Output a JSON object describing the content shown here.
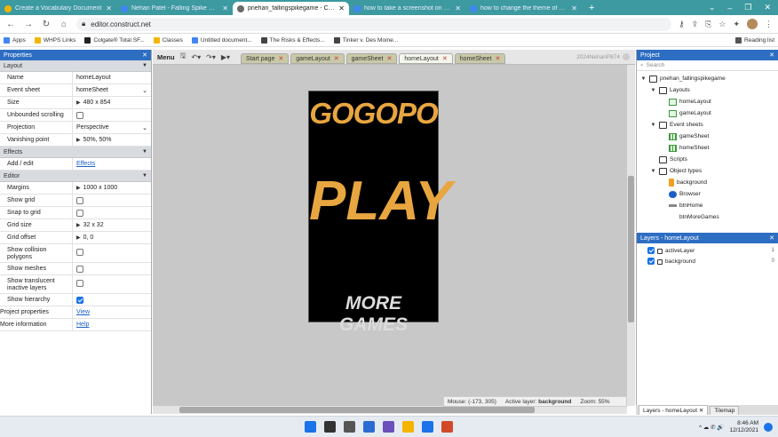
{
  "browser": {
    "tabs": [
      {
        "title": "Create a Vocabulary Document",
        "fav": "#f4b400"
      },
      {
        "title": "Nehan Patel - Falling Spike Game",
        "fav": "#4285f4"
      },
      {
        "title": "pnehan_fallingspikegame - Construct",
        "fav": "#6a6a6a"
      },
      {
        "title": "how to take a screenshot on windows",
        "fav": "#4285f4"
      },
      {
        "title": "how to change the theme of construct",
        "fav": "#4285f4"
      }
    ],
    "new_tab": "+",
    "window_controls": [
      "⌄",
      "–",
      "❐",
      "✕"
    ],
    "url": "editor.construct.net",
    "bookmarks": [
      {
        "label": "Apps",
        "color": "#4285f4"
      },
      {
        "label": "WHPS Links",
        "color": "#f4b400"
      },
      {
        "label": "Colgate® Total SF...",
        "color": "#222222"
      },
      {
        "label": "Classes",
        "color": "#f4b400"
      },
      {
        "label": "Untitled document...",
        "color": "#4285f4"
      },
      {
        "label": "The Risks & Effects...",
        "color": "#444444"
      },
      {
        "label": "Tinker v. Des Moine...",
        "color": "#444444"
      }
    ],
    "reading_list": "Reading list"
  },
  "properties": {
    "title": "Properties",
    "sections": {
      "layout": "Layout",
      "effects": "Effects",
      "editor": "Editor"
    },
    "layout_rows": {
      "name_label": "Name",
      "name_value": "homeLayout",
      "eventsheet_label": "Event sheet",
      "eventsheet_value": "homeSheet",
      "size_label": "Size",
      "size_value": "480 x 854",
      "unbounded_label": "Unbounded scrolling",
      "projection_label": "Projection",
      "projection_value": "Perspective",
      "vanishing_label": "Vanishing point",
      "vanishing_value": "50%, 50%"
    },
    "effects_rows": {
      "addedit_label": "Add / edit",
      "addedit_value": "Effects"
    },
    "editor_rows": {
      "margins_label": "Margins",
      "margins_value": "1000 x 1000",
      "showgrid_label": "Show grid",
      "snapgrid_label": "Snap to grid",
      "gridsize_label": "Grid size",
      "gridsize_value": "32 x 32",
      "gridoffset_label": "Grid offset",
      "gridoffset_value": "0, 0",
      "collision_label": "Show collision polygons",
      "meshes_label": "Show meshes",
      "translucent_label": "Show translucent inactive layers",
      "hierarchy_label": "Show hierarchy"
    },
    "project_props_label": "Project properties",
    "project_props_value": "View",
    "more_info_label": "More information",
    "more_info_value": "Help"
  },
  "editor": {
    "menu": "Menu",
    "tabs": [
      {
        "label": "Start page",
        "active": false
      },
      {
        "label": "gameLayout",
        "active": false
      },
      {
        "label": "gameSheet",
        "active": false
      },
      {
        "label": "homeLayout",
        "active": true
      },
      {
        "label": "homeSheet",
        "active": false
      }
    ],
    "user": "2024NehanP874",
    "canvas": {
      "title_text": "GOGOPO",
      "play_text": "PLAY",
      "more_games_text": "MORE GAMES"
    },
    "status": {
      "mouse": "Mouse: (-173, 305)",
      "active_layer_label": "Active layer:",
      "active_layer_value": "background",
      "zoom": "Zoom: 55%"
    }
  },
  "project": {
    "title": "Project",
    "search_placeholder": "Search",
    "tree": [
      {
        "label": "pnehan_fallingspikegame",
        "indent": 0,
        "icon": "folder",
        "arrow": "▼"
      },
      {
        "label": "Layouts",
        "indent": 1,
        "icon": "folder",
        "arrow": "▼"
      },
      {
        "label": "homeLayout",
        "indent": 2,
        "icon": "layout",
        "arrow": ""
      },
      {
        "label": "gameLayout",
        "indent": 2,
        "icon": "layout",
        "arrow": ""
      },
      {
        "label": "Event sheets",
        "indent": 1,
        "icon": "folder",
        "arrow": "▼"
      },
      {
        "label": "gameSheet",
        "indent": 2,
        "icon": "sheet",
        "arrow": ""
      },
      {
        "label": "homeSheet",
        "indent": 2,
        "icon": "sheet",
        "arrow": ""
      },
      {
        "label": "Scripts",
        "indent": 1,
        "icon": "folder",
        "arrow": ""
      },
      {
        "label": "Object types",
        "indent": 1,
        "icon": "folder",
        "arrow": "▼"
      },
      {
        "label": "background",
        "indent": 2,
        "icon": "sprite",
        "arrow": ""
      },
      {
        "label": "Browser",
        "indent": 2,
        "icon": "browser",
        "arrow": ""
      },
      {
        "label": "btnHome",
        "indent": 2,
        "icon": "btn",
        "arrow": ""
      },
      {
        "label": "btnMoreGames",
        "indent": 2,
        "icon": "none",
        "arrow": ""
      }
    ]
  },
  "layers": {
    "title": "Layers - homeLayout",
    "items": [
      {
        "label": "activeLayer",
        "num": "1"
      },
      {
        "label": "background",
        "num": "0"
      }
    ],
    "bottom_tabs": [
      "Layers - homeLayout",
      "Tilemap"
    ]
  },
  "taskbar": {
    "apps": [
      "#1a73e8",
      "#333333",
      "#555555",
      "#2b6cd4",
      "#6b4fbb",
      "#f4b400",
      "#1a73e8",
      "#d04a2a"
    ],
    "time": "8:46 AM",
    "date": "12/12/2021",
    "tray": "^  ☁  ✆  🔊"
  }
}
